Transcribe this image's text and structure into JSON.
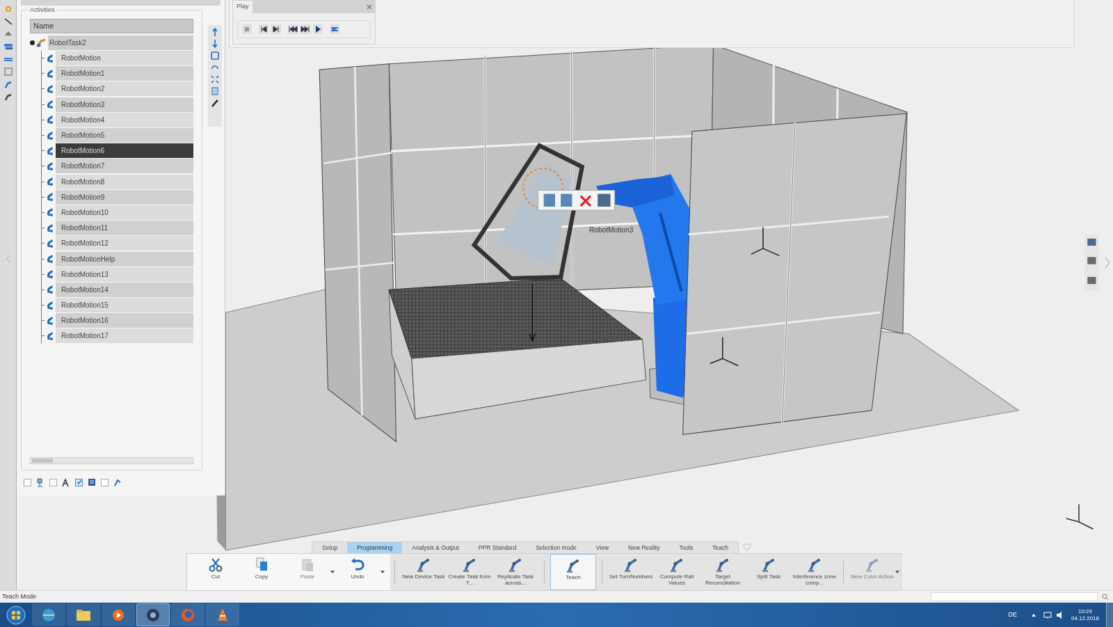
{
  "panel": {
    "group_label": "Activities",
    "column_header": "Name",
    "tree": [
      {
        "label": "RobotTask2",
        "expanded": true,
        "selected": false,
        "children": [
          {
            "label": "RobotMotion",
            "selected": false
          },
          {
            "label": "RobotMotion1",
            "selected": false
          },
          {
            "label": "RobotMotion2",
            "selected": false
          },
          {
            "label": "RobotMotion3",
            "selected": false
          },
          {
            "label": "RobotMotion4",
            "selected": false
          },
          {
            "label": "RobotMotion5",
            "selected": false
          },
          {
            "label": "RobotMotion6",
            "selected": true
          },
          {
            "label": "RobotMotion7",
            "selected": false
          },
          {
            "label": "RobotMotion8",
            "selected": false
          },
          {
            "label": "RobotMotion9",
            "selected": false
          },
          {
            "label": "RobotMotion10",
            "selected": false
          },
          {
            "label": "RobotMotion11",
            "selected": false
          },
          {
            "label": "RobotMotion12",
            "selected": false
          },
          {
            "label": "RobotMotionHelp",
            "selected": false
          },
          {
            "label": "RobotMotion13",
            "selected": false
          },
          {
            "label": "RobotMotion14",
            "selected": false
          },
          {
            "label": "RobotMotion15",
            "selected": false
          },
          {
            "label": "RobotMotion16",
            "selected": false
          },
          {
            "label": "RobotMotion17",
            "selected": false
          }
        ]
      }
    ],
    "filters": [
      {
        "checked": false
      },
      {
        "checked": false
      },
      {
        "checked": true
      },
      {
        "checked": false
      }
    ]
  },
  "play_panel": {
    "title": "Play"
  },
  "viewport": {
    "labels": [
      "RobotMotion3"
    ]
  },
  "ribbon": {
    "tabs": [
      {
        "label": "Setup",
        "selected": false
      },
      {
        "label": "Programming",
        "selected": true
      },
      {
        "label": "Analysis & Output",
        "selected": false
      },
      {
        "label": "PPR Standard",
        "selected": false
      },
      {
        "label": "Selection mode",
        "selected": false
      },
      {
        "label": "View",
        "selected": false
      },
      {
        "label": "New Reality",
        "selected": false
      },
      {
        "label": "Tools",
        "selected": false
      },
      {
        "label": "Teach",
        "selected": false
      }
    ],
    "groups": [
      [
        {
          "label": "Cut",
          "disabled": false,
          "dropdown": false,
          "selected": false
        },
        {
          "label": "Copy",
          "disabled": false,
          "dropdown": false,
          "selected": false
        },
        {
          "label": "Paste",
          "disabled": true,
          "dropdown": true,
          "selected": false
        },
        {
          "label": "Undo",
          "disabled": false,
          "dropdown": true,
          "selected": false
        }
      ],
      [
        {
          "label": "New Device Task",
          "disabled": false,
          "dropdown": false,
          "selected": false
        },
        {
          "label": "Create Task from T...",
          "disabled": false,
          "dropdown": false,
          "selected": false
        },
        {
          "label": "Replicate Task across...",
          "disabled": false,
          "dropdown": false,
          "selected": false
        }
      ],
      [
        {
          "label": "Teach",
          "disabled": false,
          "dropdown": false,
          "selected": true
        }
      ],
      [
        {
          "label": "Set TurnNumbers",
          "disabled": false,
          "dropdown": false,
          "selected": false
        },
        {
          "label": "Compute Rail Values",
          "disabled": false,
          "dropdown": false,
          "selected": false
        },
        {
          "label": "Target Reconciliation",
          "disabled": false,
          "dropdown": false,
          "selected": false
        },
        {
          "label": "Split Task",
          "disabled": false,
          "dropdown": false,
          "selected": false
        },
        {
          "label": "Interference zone comp...",
          "disabled": false,
          "dropdown": false,
          "selected": false
        }
      ],
      [
        {
          "label": "New Color Action",
          "disabled": true,
          "dropdown": true,
          "selected": false
        }
      ]
    ]
  },
  "status_bar": "Teach Mode",
  "taskbar": {
    "language": "DE",
    "time": "10:29",
    "date": "04.12.2018"
  }
}
